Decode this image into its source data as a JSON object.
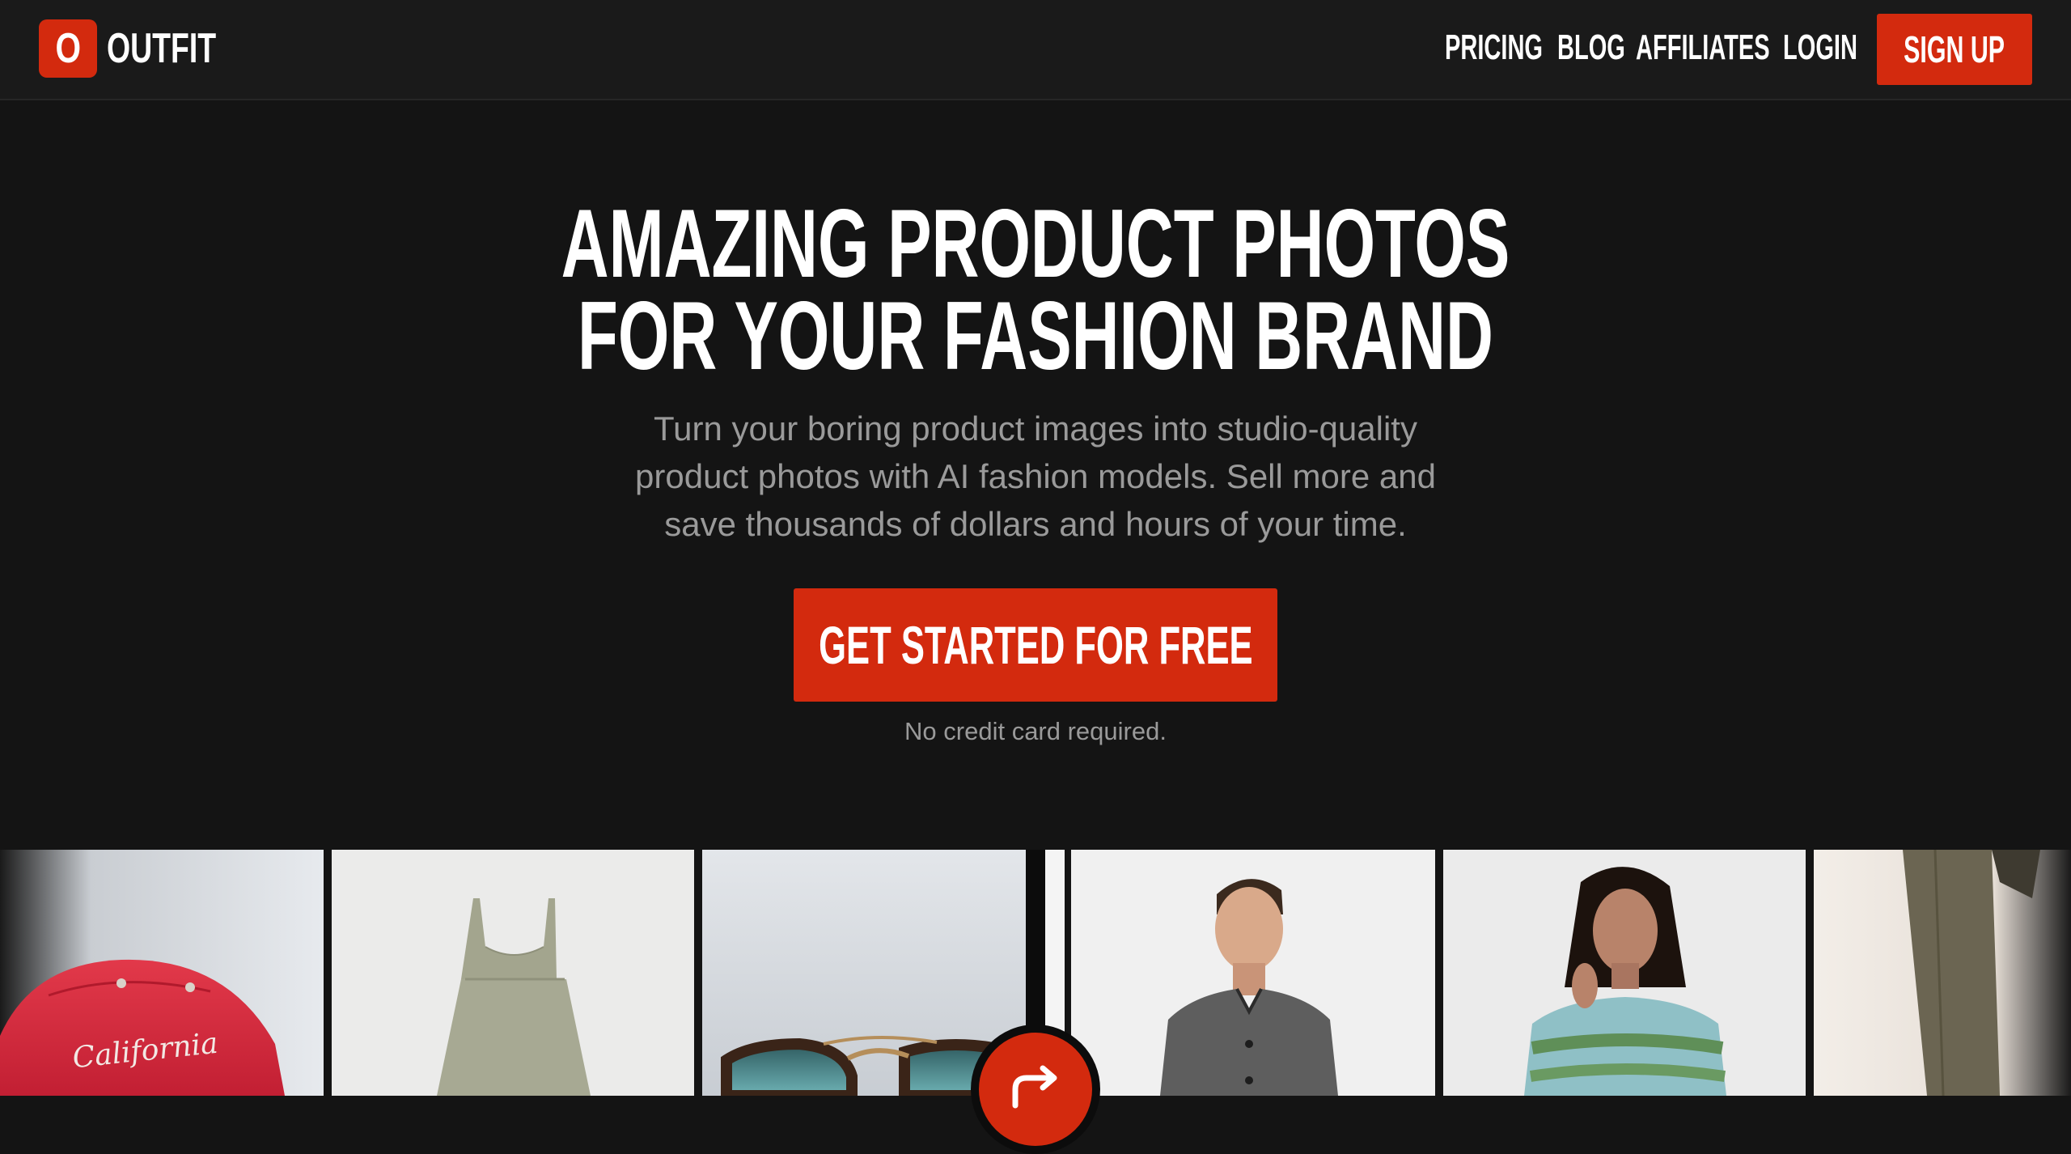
{
  "brand": {
    "logo_letter": "O",
    "name": "OUTFIT"
  },
  "nav": {
    "items": [
      "PRICING",
      "BLOG",
      "AFFILIATES",
      "LOGIN"
    ],
    "signup_label": "SIGN UP"
  },
  "hero": {
    "title_lines": [
      "AMAZING PRODUCT PHOTOS",
      "FOR YOUR FASHION BRAND"
    ],
    "subtitle_lines": [
      "Turn your boring product images into studio-quality",
      "product photos with AI fashion models. Sell more and",
      "save thousands of dollars and hours of your time."
    ],
    "cta_label": "GET STARTED FOR FREE",
    "cta_note": "No credit card required."
  },
  "gallery": {
    "cap_text": "California",
    "tiles": [
      "red-cap",
      "sage-dress",
      "sunglasses",
      "male-model-jacket",
      "female-model-sweater",
      "model-trousers"
    ]
  },
  "colors": {
    "accent": "#d32a0e",
    "background": "#141414",
    "header": "#1a1a1a",
    "muted_text": "#9a9a9a"
  },
  "icons": {
    "swap": "swap-arrow-icon"
  }
}
